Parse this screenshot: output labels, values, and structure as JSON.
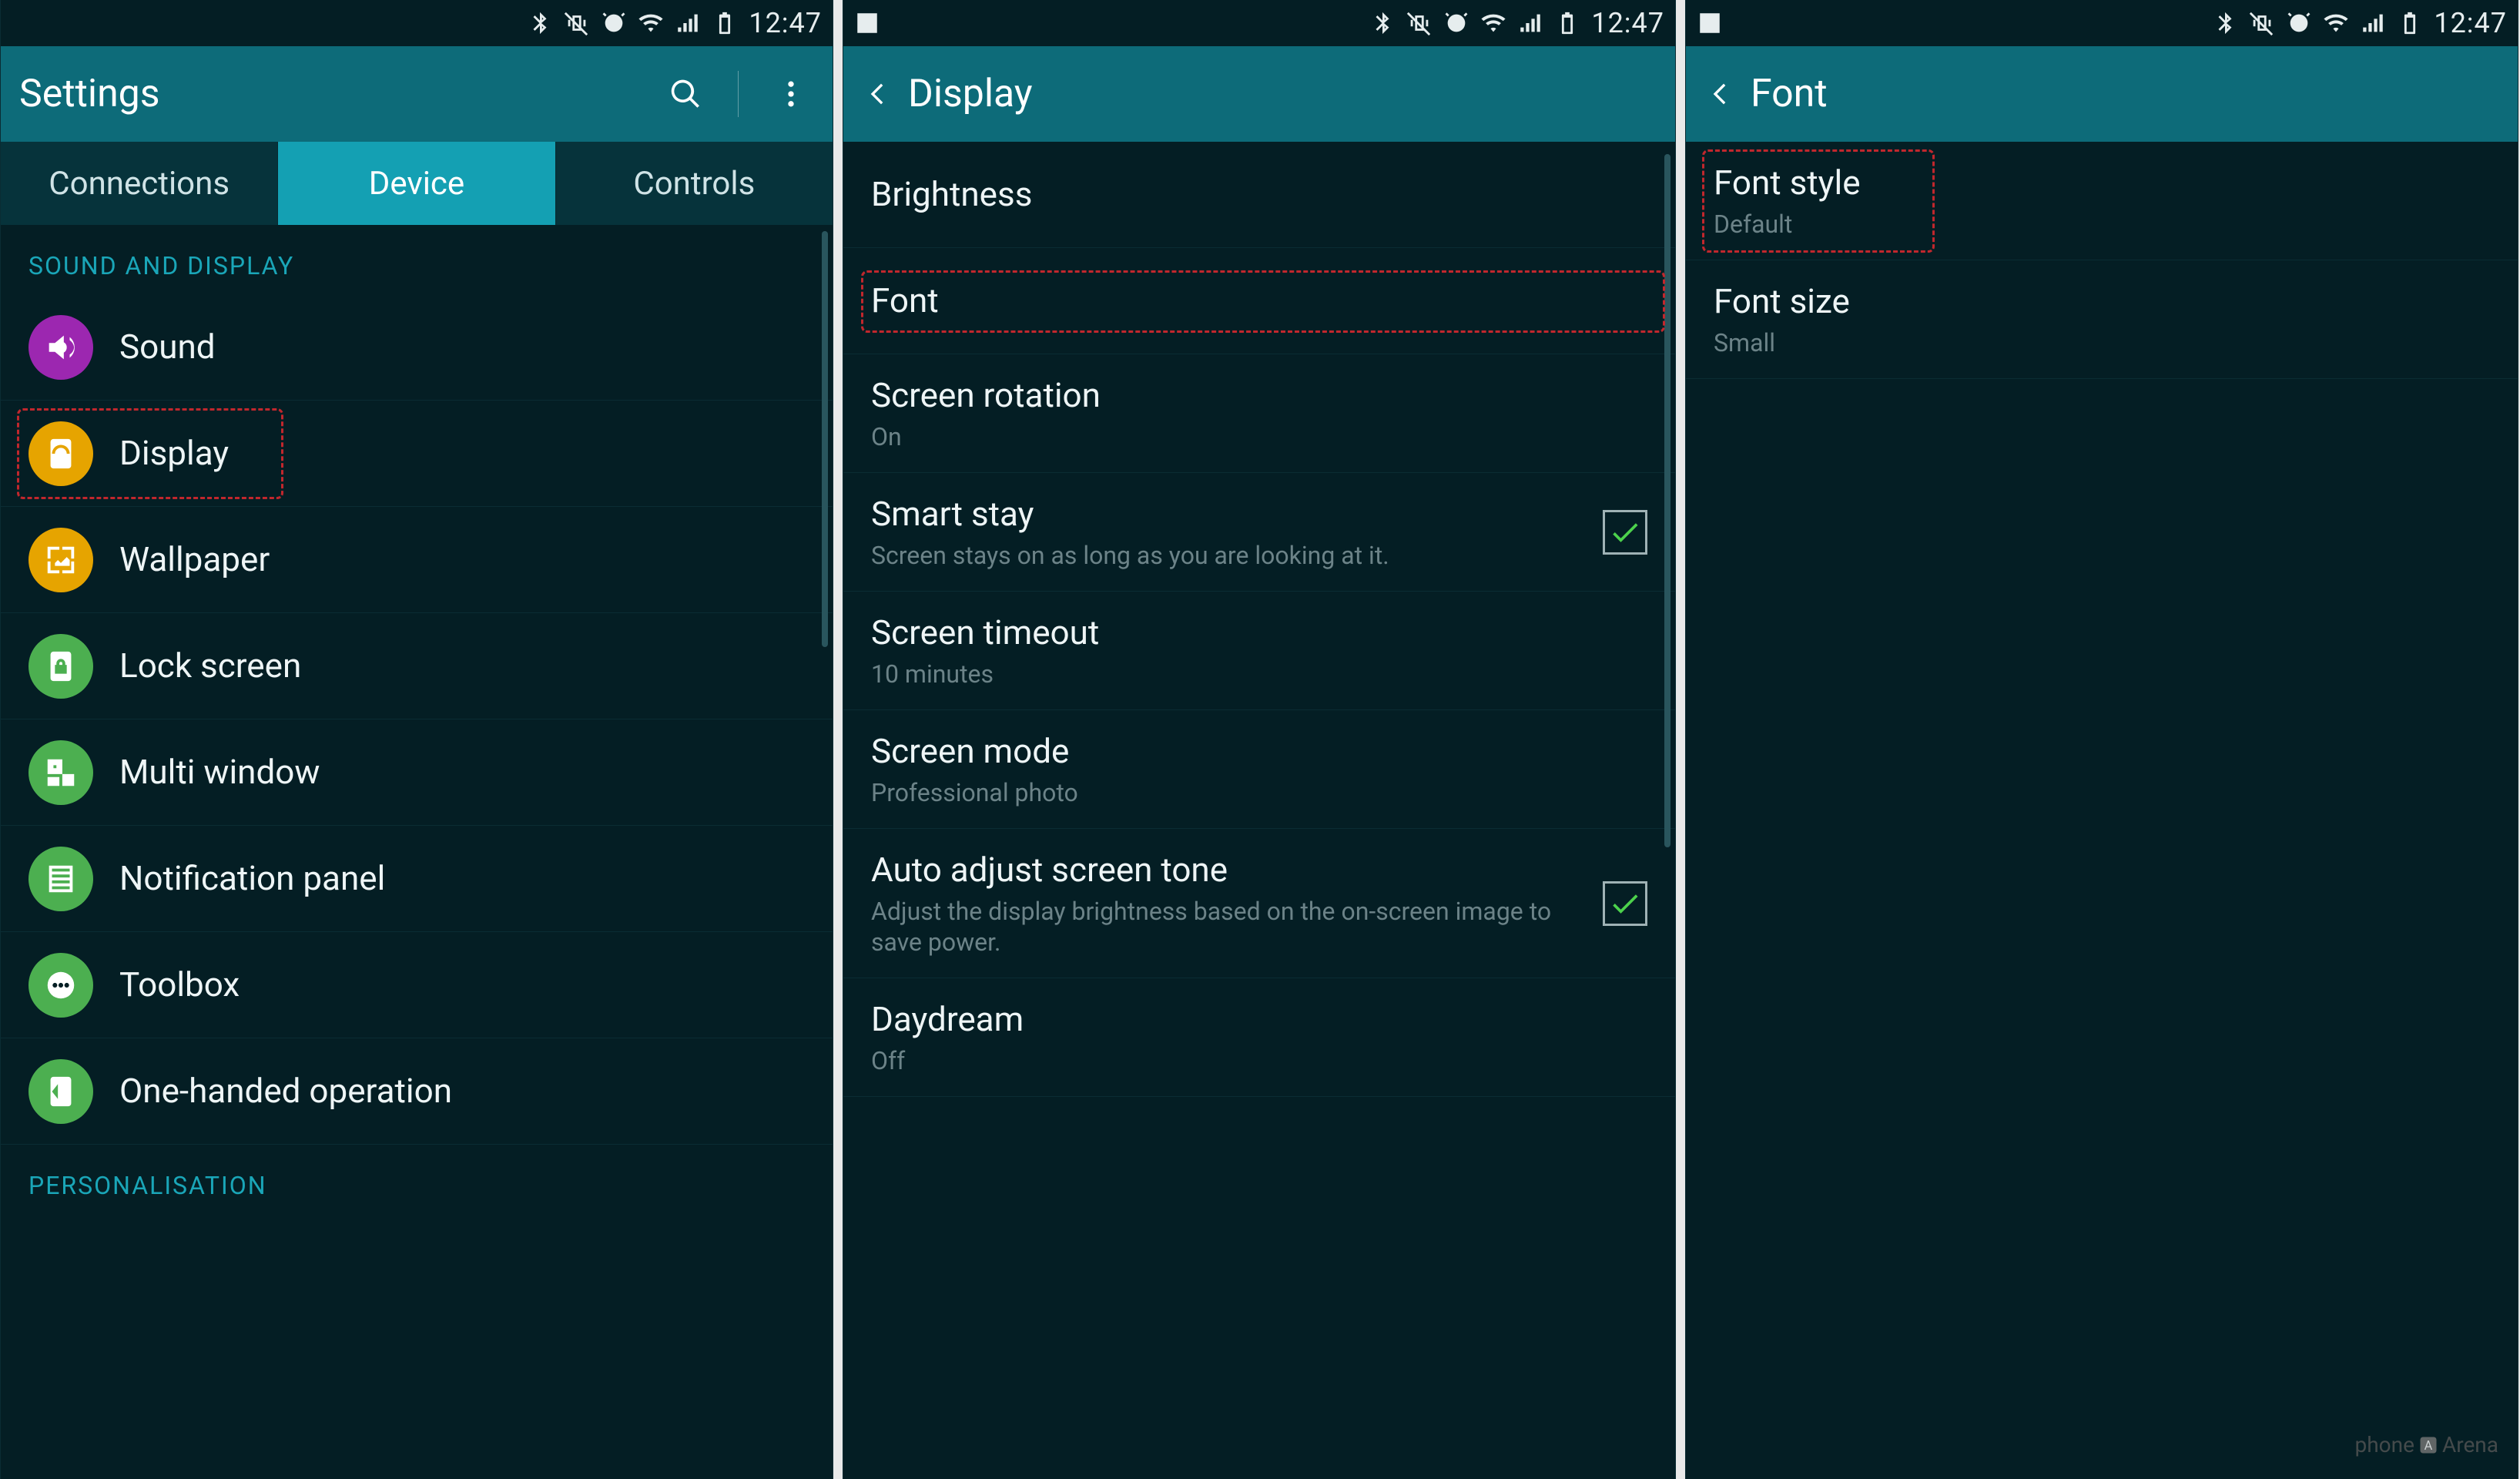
{
  "status": {
    "time": "12:47",
    "icons": [
      "image-icon",
      "bluetooth-icon",
      "mute-vibrate-icon",
      "alarm-icon",
      "wifi-icon",
      "signal-icon",
      "battery-icon"
    ]
  },
  "screens": [
    {
      "id": "settings",
      "show_image_icon": false,
      "actionbar": {
        "back": false,
        "title": "Settings",
        "search": true,
        "overflow": true
      },
      "tabs": {
        "items": [
          "Connections",
          "Device",
          "Controls"
        ],
        "active_index": 1
      },
      "sections": [
        {
          "header": "SOUND AND DISPLAY",
          "rows": [
            {
              "icon": "sound-icon",
              "icon_color": "c-purple",
              "title": "Sound"
            },
            {
              "icon": "display-icon",
              "icon_color": "c-orange",
              "title": "Display",
              "highlighted": true
            },
            {
              "icon": "wallpaper-icon",
              "icon_color": "c-orange",
              "title": "Wallpaper"
            },
            {
              "icon": "lockscreen-icon",
              "icon_color": "c-green",
              "title": "Lock screen"
            },
            {
              "icon": "multiwindow-icon",
              "icon_color": "c-green",
              "title": "Multi window"
            },
            {
              "icon": "notifpanel-icon",
              "icon_color": "c-green",
              "title": "Notification panel"
            },
            {
              "icon": "toolbox-icon",
              "icon_color": "c-green",
              "title": "Toolbox"
            },
            {
              "icon": "onehanded-icon",
              "icon_color": "c-green",
              "title": "One-handed operation"
            }
          ]
        },
        {
          "header": "PERSONALISATION",
          "rows": []
        }
      ]
    },
    {
      "id": "display",
      "show_image_icon": true,
      "actionbar": {
        "back": true,
        "title": "Display",
        "search": false,
        "overflow": false
      },
      "rows": [
        {
          "title": "Brightness"
        },
        {
          "title": "Font",
          "highlighted": true,
          "highlight_tight": true
        },
        {
          "title": "Screen rotation",
          "sub": "On"
        },
        {
          "title": "Smart stay",
          "sub": "Screen stays on as long as you are looking at it.",
          "checked": true
        },
        {
          "title": "Screen timeout",
          "sub": "10 minutes"
        },
        {
          "title": "Screen mode",
          "sub": "Professional photo"
        },
        {
          "title": "Auto adjust screen tone",
          "sub": "Adjust the display brightness based on the on-screen image to save power.",
          "checked": true
        },
        {
          "title": "Daydream",
          "sub": "Off"
        }
      ]
    },
    {
      "id": "font",
      "show_image_icon": true,
      "actionbar": {
        "back": true,
        "title": "Font",
        "search": false,
        "overflow": false
      },
      "rows": [
        {
          "title": "Font style",
          "sub": "Default",
          "highlighted": true
        },
        {
          "title": "Font size",
          "sub": "Small"
        }
      ]
    }
  ],
  "watermark": {
    "text_left": "phone",
    "text_right": "Arena"
  }
}
